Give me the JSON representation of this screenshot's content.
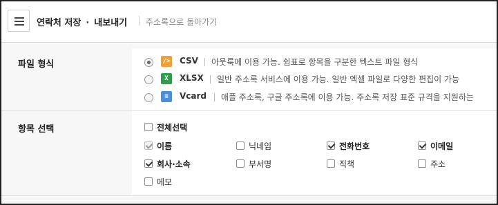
{
  "header": {
    "title_part1": "연락처 저장",
    "title_separator": "·",
    "title_part2": "내보내기",
    "back_link": "주소록으로 돌아가기"
  },
  "format_section": {
    "title": "파일 형식",
    "options": [
      {
        "name": "CSV",
        "icon": "csv-code-icon",
        "icon_glyph": "/>",
        "selected": true,
        "description": "아웃룩에 이용 가능. 쉼표로 항목을 구분한 텍스트 파일 형식"
      },
      {
        "name": "XLSX",
        "icon": "excel-icon",
        "icon_glyph": "X",
        "selected": false,
        "description": "일반 주소록 서비스에 이용 가능. 일반 엑셀 파일로 다양한 편집이 가능"
      },
      {
        "name": "Vcard",
        "icon": "contact-card-icon",
        "icon_glyph": "≡",
        "selected": false,
        "description": "애플 주소록, 구글 주소록에 이용 가능. 주소록 저장 표준 규격을 지원하는"
      }
    ]
  },
  "fields_section": {
    "title": "항목 선택",
    "select_all": {
      "label": "전체선택",
      "checked": false
    },
    "items": [
      {
        "label": "이름",
        "checked": true,
        "disabled": true
      },
      {
        "label": "닉네임",
        "checked": false,
        "disabled": false
      },
      {
        "label": "전화번호",
        "checked": true,
        "disabled": false
      },
      {
        "label": "이메일",
        "checked": true,
        "disabled": false
      },
      {
        "label": "회사·소속",
        "checked": true,
        "disabled": false
      },
      {
        "label": "부서명",
        "checked": false,
        "disabled": false
      },
      {
        "label": "직책",
        "checked": false,
        "disabled": false
      },
      {
        "label": "주소",
        "checked": false,
        "disabled": false
      },
      {
        "label": "메모",
        "checked": false,
        "disabled": false
      }
    ]
  },
  "colors": {
    "csv_icon": "#f0a23a",
    "xlsx_icon": "#2e9d4e",
    "vcard_icon": "#4a90d9",
    "label_bg": "#f7f7f7"
  }
}
